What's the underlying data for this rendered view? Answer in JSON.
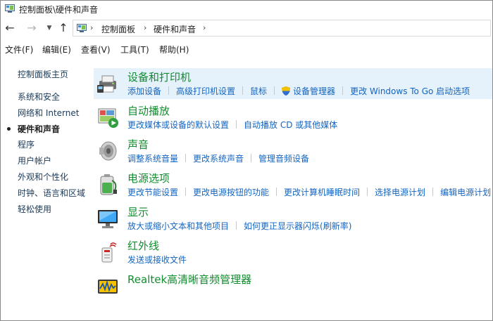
{
  "window": {
    "title": "控制面板\\硬件和声音"
  },
  "breadcrumb": {
    "items": [
      "控制面板",
      "硬件和声音"
    ]
  },
  "menu": {
    "items": [
      "文件(F)",
      "编辑(E)",
      "查看(V)",
      "工具(T)",
      "帮助(H)"
    ]
  },
  "left_nav": {
    "home": "控制面板主页",
    "items": [
      {
        "label": "系统和安全",
        "current": false
      },
      {
        "label": "网络和 Internet",
        "current": false
      },
      {
        "label": "硬件和声音",
        "current": true
      },
      {
        "label": "程序",
        "current": false
      },
      {
        "label": "用户帐户",
        "current": false
      },
      {
        "label": "外观和个性化",
        "current": false
      },
      {
        "label": "时钟、语言和区域",
        "current": false
      },
      {
        "label": "轻松使用",
        "current": false
      }
    ]
  },
  "categories": [
    {
      "title": "设备和打印机",
      "icon": "printer-icon",
      "links": [
        "添加设备",
        "高级打印机设置",
        "鼠标",
        "设备管理器",
        "更改 Windows To Go 启动选项"
      ]
    },
    {
      "title": "自动播放",
      "icon": "autoplay-icon",
      "links": [
        "更改媒体或设备的默认设置",
        "自动播放 CD 或其他媒体"
      ]
    },
    {
      "title": "声音",
      "icon": "speaker-icon",
      "links": [
        "调整系统音量",
        "更改系统声音",
        "管理音频设备"
      ]
    },
    {
      "title": "电源选项",
      "icon": "battery-icon",
      "links": [
        "更改节能设置",
        "更改电源按钮的功能",
        "更改计算机睡眠时间",
        "选择电源计划",
        "编辑电源计划"
      ]
    },
    {
      "title": "显示",
      "icon": "monitor-icon",
      "links": [
        "放大或缩小文本和其他项目",
        "如何更正显示器闪烁(刷新率)"
      ]
    },
    {
      "title": "红外线",
      "icon": "infrared-icon",
      "links": [
        "发送或接收文件"
      ]
    },
    {
      "title": "Realtek高清晰音频管理器",
      "icon": "realtek-audio-icon",
      "links": []
    }
  ],
  "colors": {
    "category_title": "#128c2f",
    "link": "#1565c0",
    "selected_bg": "#e5f1fb"
  }
}
